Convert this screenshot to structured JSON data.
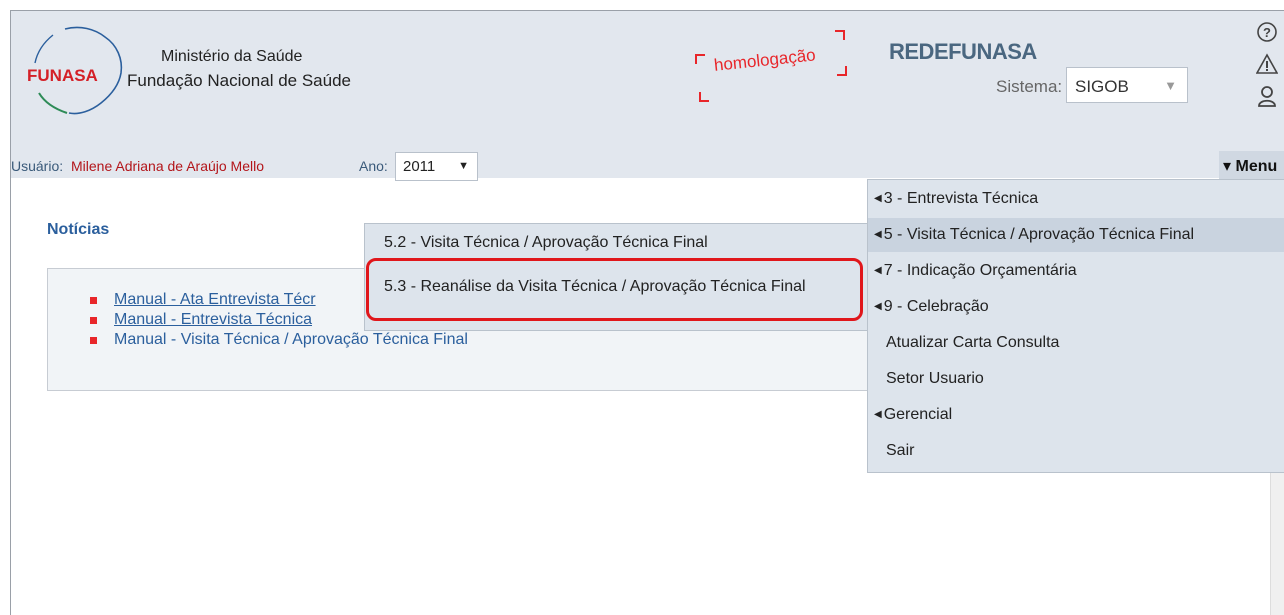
{
  "header": {
    "logo_text": "FUNASA",
    "org_line1": "Ministério da Saúde",
    "org_line2": "Fundação Nacional de Saúde",
    "environment_stamp": "homologação",
    "network_name": "REDEFUNASA",
    "sistema_label": "Sistema:",
    "sistema_value": "SIGOB",
    "icons": [
      "help-icon",
      "warning-icon",
      "user-icon"
    ]
  },
  "user_bar": {
    "user_label": "Usuário:",
    "user_name": "Milene Adriana de Araújo Mello",
    "year_label": "Ano:",
    "year_value": "2011",
    "menu_label": "Menu"
  },
  "news": {
    "title": "Notícias",
    "items": [
      "Manual - Ata Entrevista Técr",
      "Manual - Entrevista Técnica",
      "Manual - Visita Técnica / Aprovação Técnica Final"
    ]
  },
  "main_menu": {
    "items": [
      "3 - Entrevista Técnica",
      "5 - Visita Técnica / Aprovação Técnica Final",
      "7 - Indicação Orçamentária",
      "9 - Celebração",
      "Atualizar Carta Consulta",
      "Setor Usuario",
      "Gerencial",
      "Sair"
    ]
  },
  "sub_menu": {
    "items": [
      "5.2 - Visita Técnica / Aprovação Técnica Final",
      "5.3 - Reanálise da Visita Técnica / Aprovação Técnica Final"
    ]
  },
  "colors": {
    "header_bg": "#e2e7ee",
    "accent_red": "#e8262a",
    "link_blue": "#2b5f9d",
    "menu_bg": "#dde4ec"
  }
}
